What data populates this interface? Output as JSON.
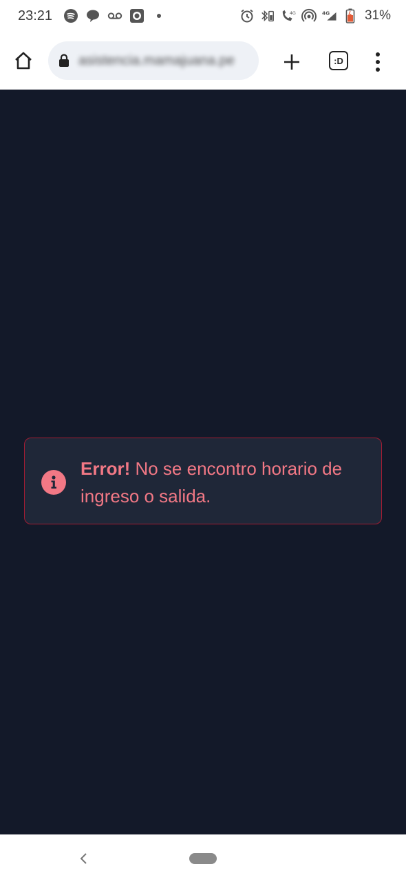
{
  "status_bar": {
    "time": "23:21",
    "battery_percent": "31%",
    "left_icons": [
      "spotify-icon",
      "chat-bubble-icon",
      "voicemail-icon",
      "record-icon",
      "dot-icon"
    ],
    "right_icons": [
      "alarm-icon",
      "bluetooth-battery-icon",
      "wifi-calling-icon",
      "hotspot-icon",
      "signal-4g-icon",
      "battery-icon"
    ],
    "network_label": "4G"
  },
  "browser": {
    "url": "asistencia.mamajuana.pe",
    "tab_count_label": ":D"
  },
  "alert": {
    "strong_label": "Error!",
    "message": " No se encontro horario de ingreso o salida.",
    "accent_color": "#f27885",
    "border_color": "#a11d33"
  },
  "page": {
    "background_color": "#131929"
  }
}
